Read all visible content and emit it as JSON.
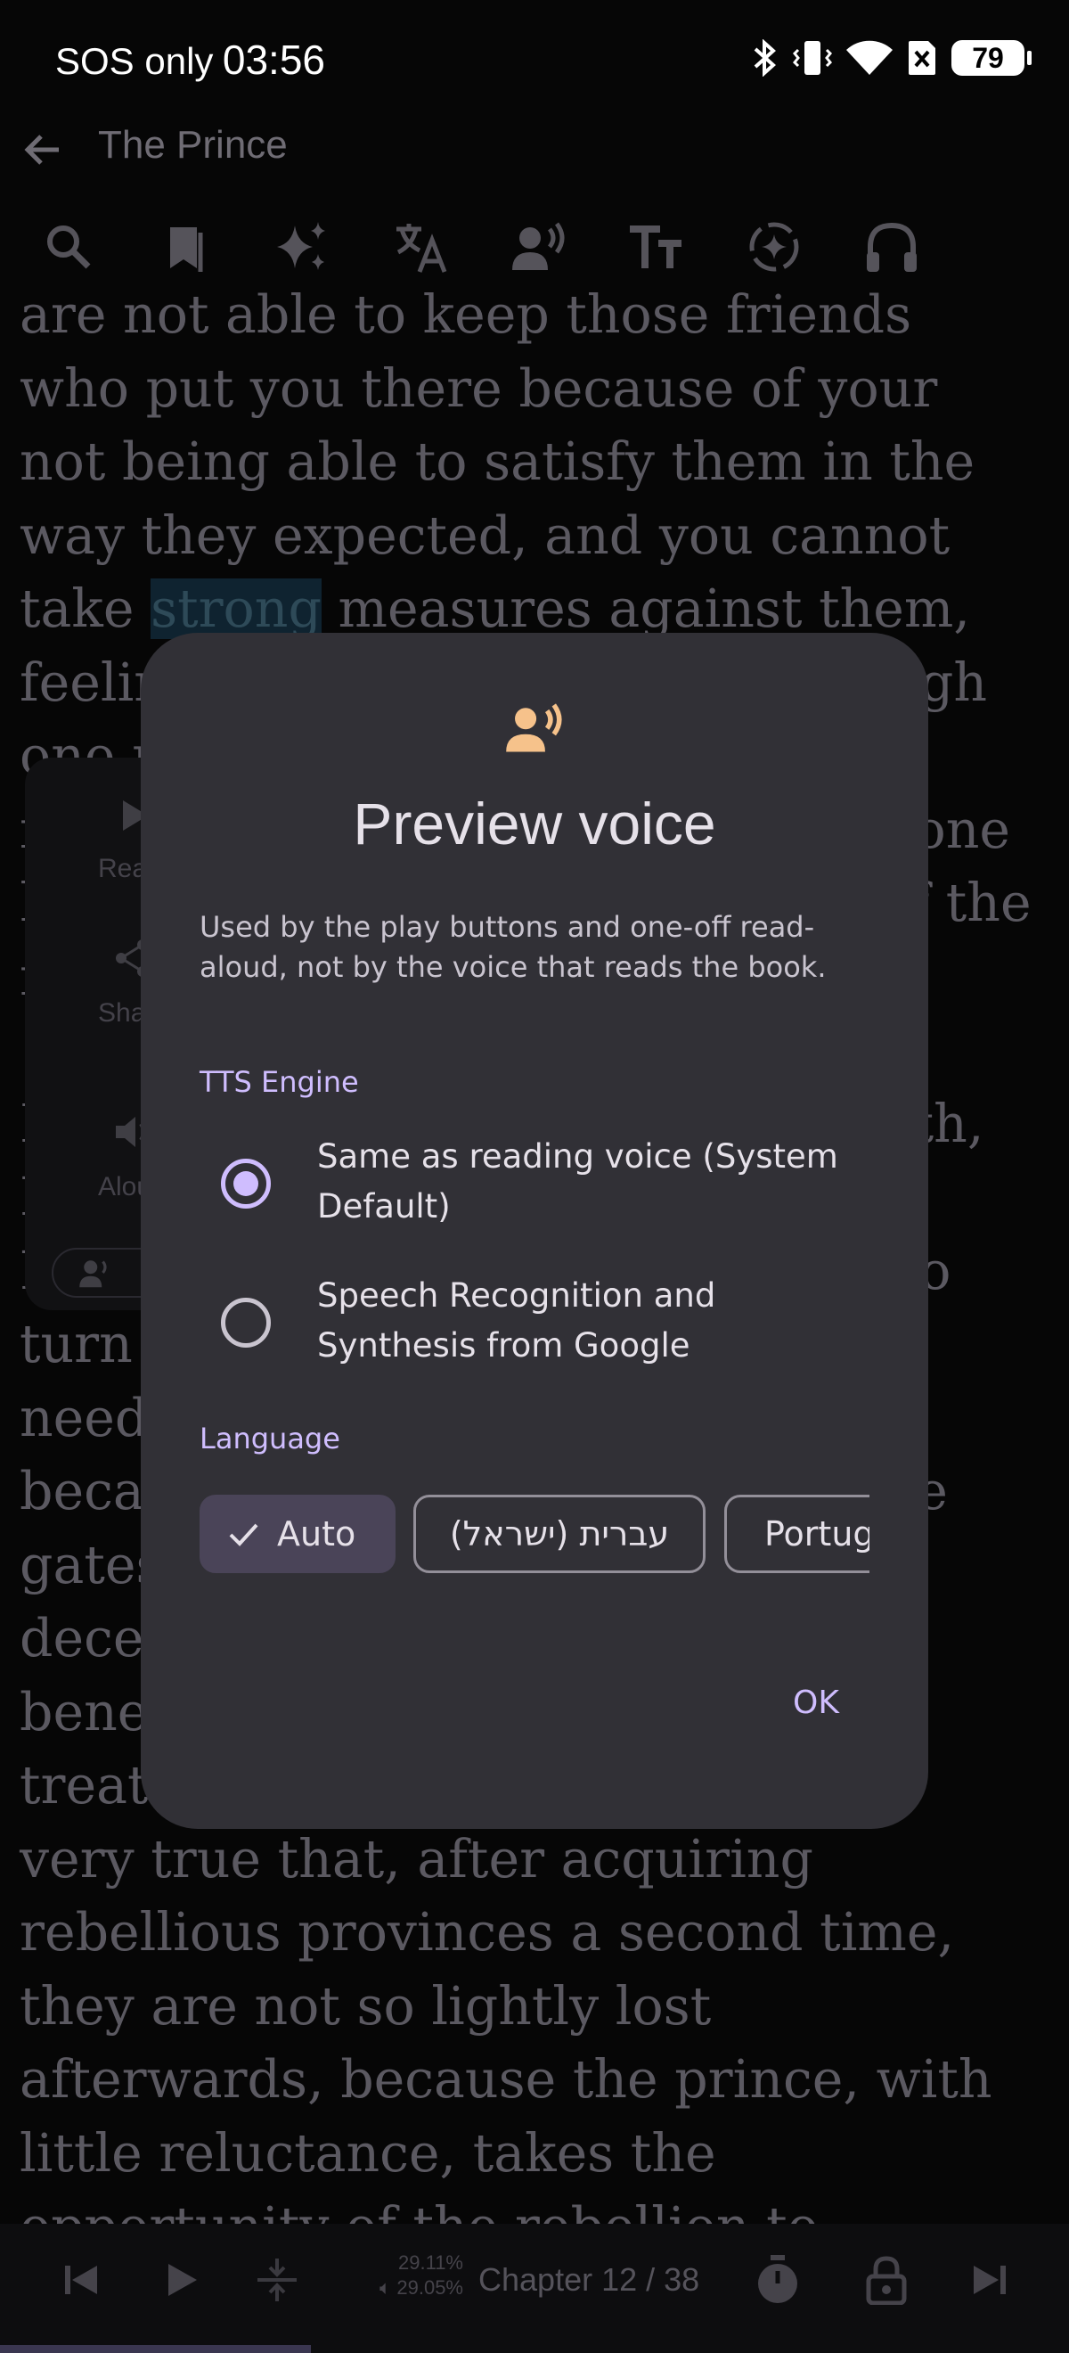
{
  "status_bar": {
    "carrier": "SOS only",
    "time": "03:56",
    "battery": "79",
    "icons": [
      "bluetooth-icon",
      "vibrate-icon",
      "wifi-icon",
      "sim-off-icon",
      "battery-icon"
    ]
  },
  "app_bar": {
    "title": "The Prince",
    "toolbar_icons": [
      "search-icon",
      "bookmark-icon",
      "sparkle-icon",
      "translate-icon",
      "voice-icon",
      "text-size-icon",
      "focus-icon",
      "headphones-icon"
    ]
  },
  "reader": {
    "before_highlight": "are not able to keep those friends\nwho put you there because of your\nnot being able to satisfy them in the\nway they expected, and you cannot\ntake ",
    "highlight": "strong",
    "after_highlight": " measures against them,\nfeeling bound to them. For, although\none may be very strong in armed\nforces, yet in entering a province one\nhas always need of the goodwill of the\nnatives.\n\nFor these reasons Louis the Twelfth,\nKing of France, quickly occupied\nMilan, and as quickly lost it; and to\nturn him out the first time it only\nneeded Lodovico's own forces;\nbecause those who had opened the\ngates to him, finding themselves\ndeceived in their hopes of future\nbenefit, would not endure the ill-\ntreatment of the new prince. It is\nvery true that, after acquiring\nrebellious provinces a second time,\nthey are not so lightly lost\nafterwards, because the prince, with\nlittle reluctance, takes the\nopportunity of the rebellion to"
  },
  "selection_menu": {
    "items": [
      "Read",
      "Share",
      "Aloud"
    ]
  },
  "bottom_bar": {
    "reading_progress": "29.11%",
    "audio_progress": "29.05%",
    "chapter": "Chapter 12 / 38",
    "progress_fraction": 0.2911
  },
  "dialog": {
    "title": "Preview voice",
    "description": "Used by the play buttons and one-off read-aloud, not by the voice that reads the book.",
    "tts_section": "TTS Engine",
    "engines": [
      {
        "label": "Same as reading voice (System Default)",
        "selected": true
      },
      {
        "label": "Speech Recognition and Synthesis from Google",
        "selected": false
      }
    ],
    "language_section": "Language",
    "languages": [
      {
        "label": "Auto",
        "selected": true
      },
      {
        "label": "עברית (ישראל)",
        "selected": false
      },
      {
        "label": "Portugu",
        "selected": false
      }
    ],
    "ok_label": "OK"
  },
  "colors": {
    "accent": "#cfbdfe",
    "icon_accent": "#f6c28b",
    "dialog_bg": "#313036"
  }
}
